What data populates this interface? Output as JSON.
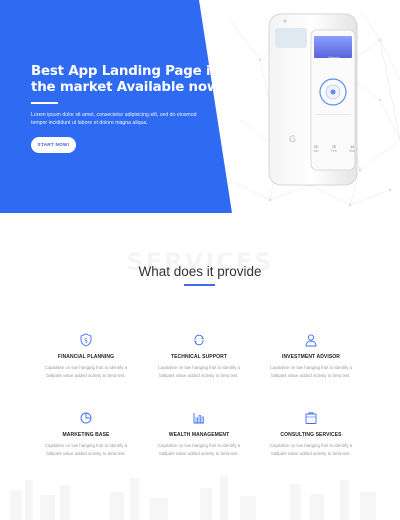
{
  "hero": {
    "title_line1": "Best App Landing Page in",
    "title_line2": "the market Available now",
    "description": "Lorem ipsum dolor sit amet, consectetur adipisicing elit, sed do eiusmod tempor incididunt ut labore et dolore magna aliqua.",
    "cta_label": "START NOW!",
    "accent_color": "#2f6bf2"
  },
  "phone": {
    "month": "March",
    "stats": [
      {
        "value": "20",
        "label": "Jan"
      },
      {
        "value": "78",
        "label": "Feb"
      },
      {
        "value": "14",
        "label": "Mar"
      }
    ]
  },
  "services": {
    "background_word": "SERVICES",
    "title": "What does it provide",
    "features": [
      {
        "icon": "shield-dollar-icon",
        "title": "FINANCIAL PLANNING",
        "desc_line1": "Capitalise on low hanging fruit to identify a",
        "desc_line2": "ballpark value added activity to beta test."
      },
      {
        "icon": "refresh-gear-icon",
        "title": "TECHNICAL SUPPORT",
        "desc_line1": "Capitalise on low hanging fruit to identify a",
        "desc_line2": "ballpark value added activity to beta test."
      },
      {
        "icon": "user-icon",
        "title": "INVESTMENT ADVISOR",
        "desc_line1": "Capitalise on low hanging fruit to identify a",
        "desc_line2": "ballpark value added activity to beta test."
      },
      {
        "icon": "pie-chart-icon",
        "title": "MARKETING BASE",
        "desc_line1": "Capitalise on low hanging fruit to identify a",
        "desc_line2": "ballpark value added activity to beta test."
      },
      {
        "icon": "bar-chart-icon",
        "title": "WEALTH MANAGEMENT",
        "desc_line1": "Capitalise on low hanging fruit to identify a",
        "desc_line2": "ballpark value added activity to beta test."
      },
      {
        "icon": "briefcase-icon",
        "title": "CONSULTING SERVICES",
        "desc_line1": "Capitalise on low hanging fruit to identify a",
        "desc_line2": "ballpark value added activity to beta test."
      }
    ]
  }
}
